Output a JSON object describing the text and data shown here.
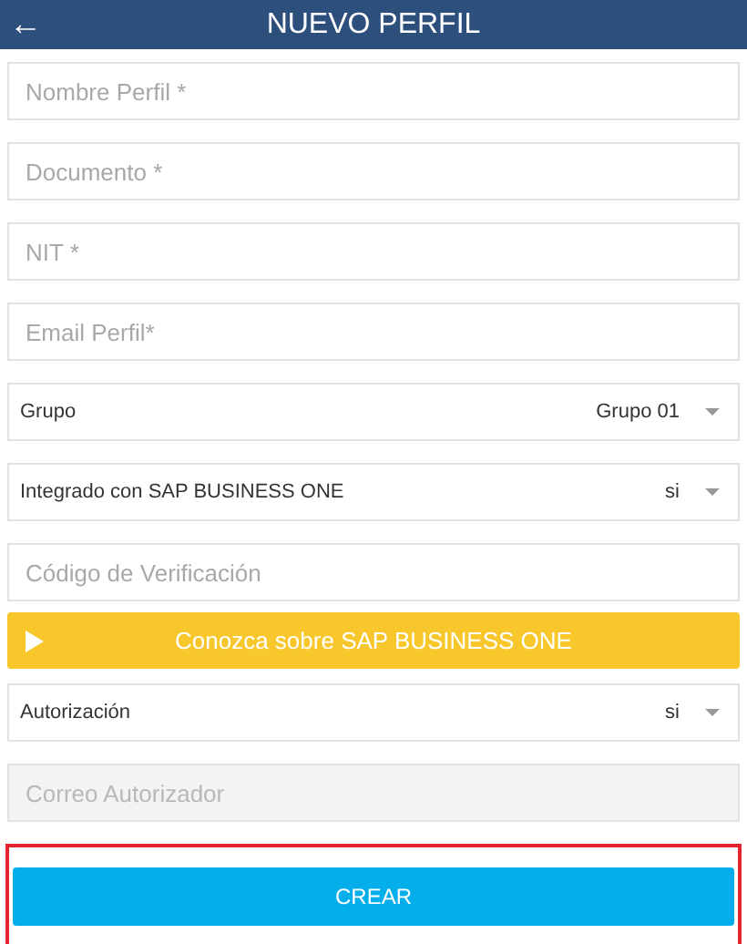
{
  "header": {
    "back_icon": "←",
    "title": "NUEVO PERFIL"
  },
  "form": [
    {
      "kind": "field",
      "placeholder": "Nombre Perfil *",
      "disabled": false
    },
    {
      "kind": "field",
      "placeholder": "Documento *",
      "disabled": false
    },
    {
      "kind": "field",
      "placeholder": "NIT *",
      "disabled": false
    },
    {
      "kind": "field",
      "placeholder": "Email Perfil*",
      "disabled": false
    },
    {
      "kind": "select",
      "label": "Grupo",
      "value": "Grupo 01"
    },
    {
      "kind": "select",
      "label": "Integrado con SAP BUSINESS ONE",
      "value": "si"
    },
    {
      "kind": "field",
      "placeholder": "Código de Verificación",
      "disabled": false
    },
    {
      "kind": "banner",
      "label": "Conozca sobre SAP BUSINESS ONE"
    },
    {
      "kind": "select",
      "label": "Autorización",
      "value": "si"
    },
    {
      "kind": "field",
      "placeholder": "Correo Autorizador",
      "disabled": true
    },
    {
      "kind": "button",
      "label": "CREAR",
      "highlighted": true
    }
  ]
}
